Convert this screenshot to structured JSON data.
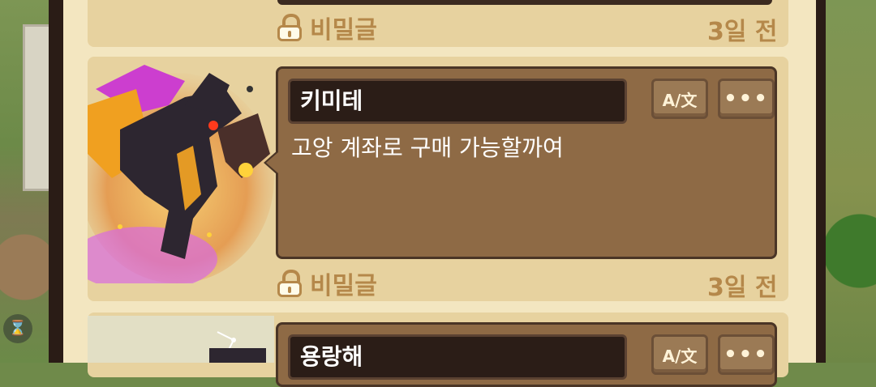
{
  "posts": [
    {
      "visibility": "비밀글",
      "time": "3일 전"
    },
    {
      "author": "키미테",
      "message": "고앙 계좌로 구매 가능할까여",
      "visibility": "비밀글",
      "time": "3일 전",
      "avatar_icon": "dark-dragon-icon"
    },
    {
      "author": "용랑해",
      "avatar_icon": "constellation-character-icon"
    }
  ],
  "buttons": {
    "translate_label": "A/文",
    "more_label": "•••"
  },
  "colors": {
    "panel": "#f3e6c0",
    "card": "#e7d29f",
    "bubble": "#8e6a45",
    "accent": "#b5884a"
  }
}
